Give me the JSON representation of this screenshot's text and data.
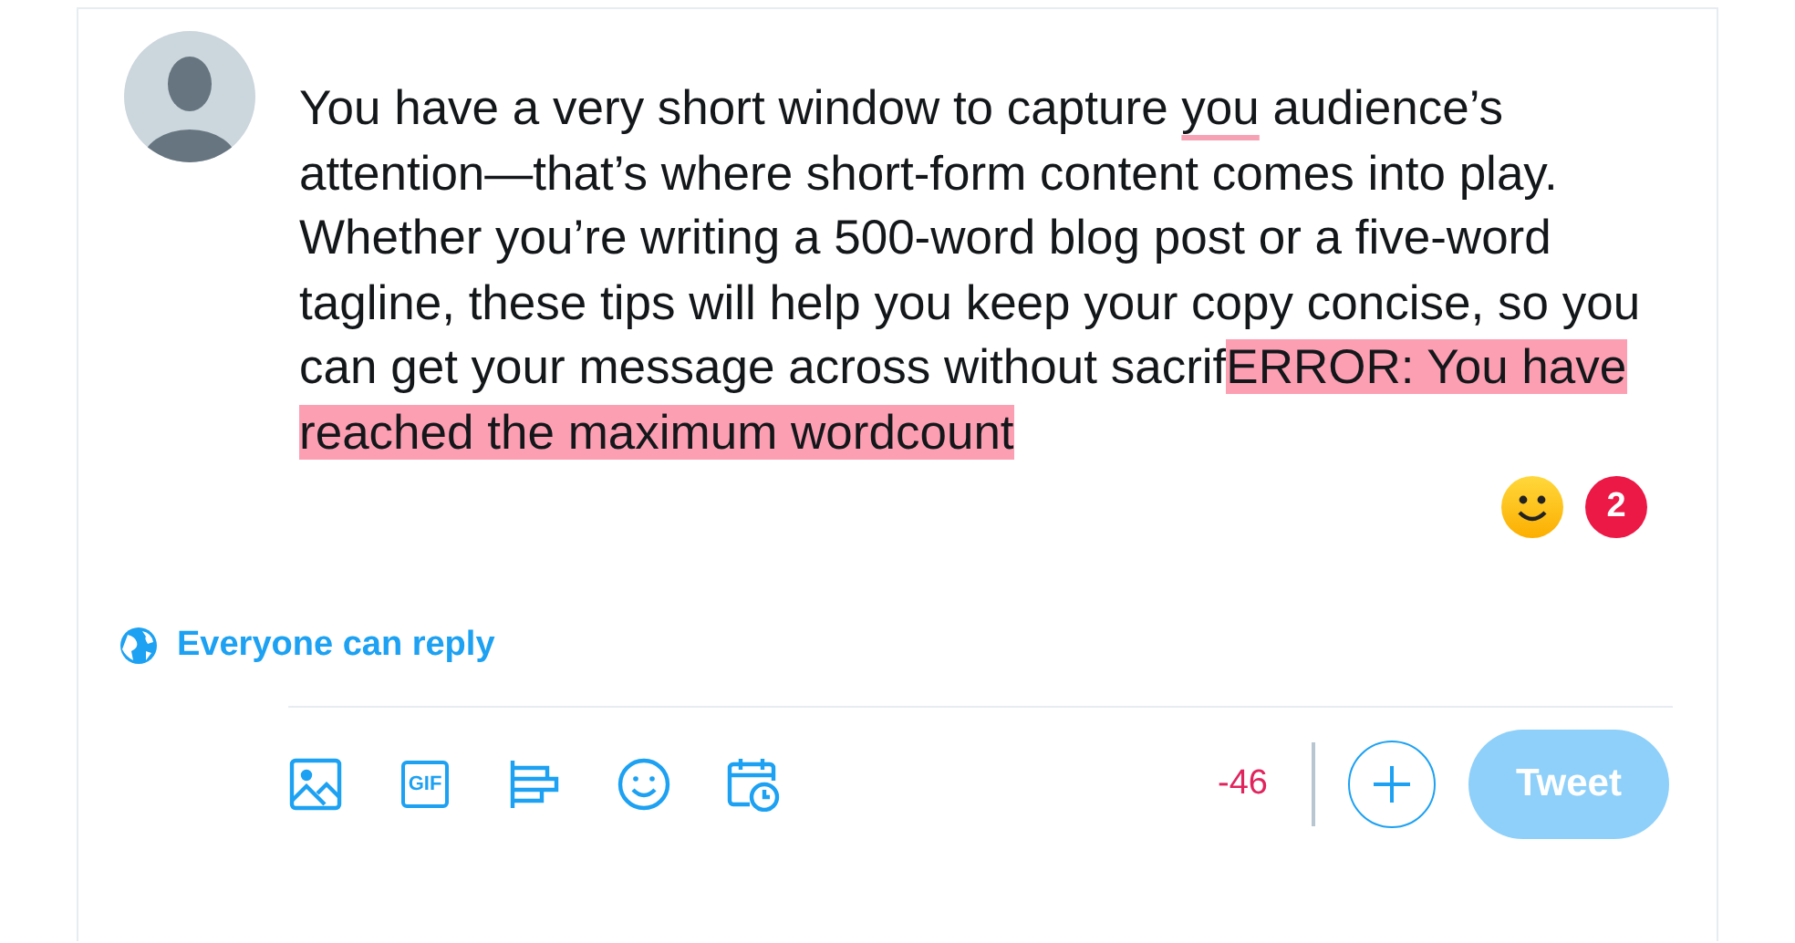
{
  "composer": {
    "segments": [
      {
        "text": "You have a very short window to capture ",
        "kind": "plain"
      },
      {
        "text": "you",
        "kind": "misspelled"
      },
      {
        "text": " audience’s attention—that’s where short-form content comes into play. Whether you’re writing a 500-word blog post or a five-word tagline, these tips will help you keep your copy concise, so you can get your message across without sacrif",
        "kind": "plain"
      },
      {
        "text": "ERROR: You have reached the maximum wordcount",
        "kind": "overflow"
      }
    ],
    "issue_count": "2"
  },
  "reply_setting": "Everyone can reply",
  "toolbar": {
    "tools": [
      {
        "kind": "image"
      },
      {
        "kind": "gif",
        "label": "GIF"
      },
      {
        "kind": "poll"
      },
      {
        "kind": "emoji"
      },
      {
        "kind": "schedule"
      }
    ],
    "counter": "-46",
    "tweet_button": {
      "label": "Tweet",
      "disabled": true
    }
  }
}
